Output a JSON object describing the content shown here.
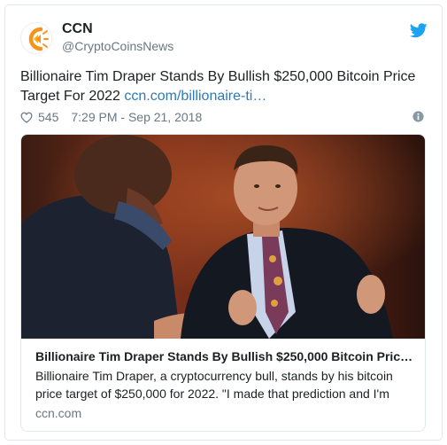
{
  "account": {
    "name": "CCN",
    "handle": "@CryptoCoinsNews"
  },
  "tweet": {
    "text": "Billionaire Tim Draper Stands By Bullish $250,000 Bitcoin Price Target For 2022",
    "link": "ccn.com/billionaire-ti…",
    "likes": "545",
    "timestamp": "7:29 PM - Sep 21, 2018"
  },
  "card": {
    "title": "Billionaire Tim Draper Stands By Bullish $250,000 Bitcoin Pric…",
    "description": "Billionaire Tim Draper, a cryptocurrency bull, stands by his bitcoin price target of $250,000 for 2022. \"I made that prediction and I'm",
    "domain": "ccn.com"
  },
  "icons": {
    "avatar": "ccn-logo-icon",
    "brand": "twitter-bird-icon",
    "like": "heart-icon",
    "info": "info-icon"
  },
  "colors": {
    "link": "#2b7bb9",
    "muted": "#697882",
    "twitter_blue": "#1da1f2",
    "logo_orange": "#f7931a"
  }
}
